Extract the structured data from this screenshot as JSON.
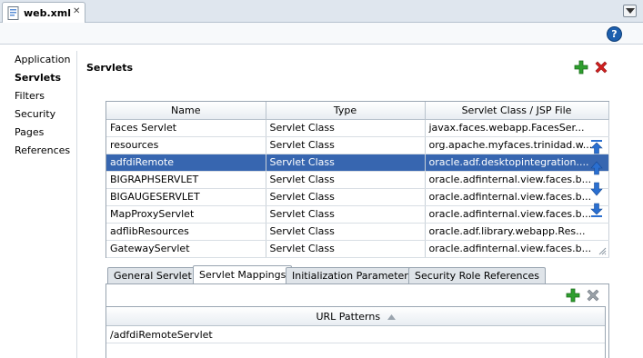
{
  "editor_tab": {
    "title": "web.xml",
    "close": "✕"
  },
  "help": {
    "label": "?"
  },
  "nav": {
    "items": [
      {
        "label": "Application",
        "selected": false
      },
      {
        "label": "Servlets",
        "selected": true
      },
      {
        "label": "Filters",
        "selected": false
      },
      {
        "label": "Security",
        "selected": false
      },
      {
        "label": "Pages",
        "selected": false
      },
      {
        "label": "References",
        "selected": false
      }
    ]
  },
  "servlets": {
    "title": "Servlets",
    "columns": [
      "Name",
      "Type",
      "Servlet Class / JSP File"
    ],
    "rows": [
      [
        "Faces Servlet",
        "Servlet Class",
        "javax.faces.webapp.FacesSer..."
      ],
      [
        "resources",
        "Servlet Class",
        "org.apache.myfaces.trinidad.w..."
      ],
      [
        "adfdiRemote",
        "Servlet Class",
        "oracle.adf.desktopintegration...."
      ],
      [
        "BIGRAPHSERVLET",
        "Servlet Class",
        "oracle.adfinternal.view.faces.b..."
      ],
      [
        "BIGAUGESERVLET",
        "Servlet Class",
        "oracle.adfinternal.view.faces.b..."
      ],
      [
        "MapProxyServlet",
        "Servlet Class",
        "oracle.adfinternal.view.faces.b..."
      ],
      [
        "adflibResources",
        "Servlet Class",
        "oracle.adf.library.webapp.Res..."
      ],
      [
        "GatewayServlet",
        "Servlet Class",
        "oracle.adfinternal.view.faces.b..."
      ]
    ],
    "selected_row": 2
  },
  "detail_tabs": {
    "tabs": [
      "General Servlet",
      "Servlet Mappings",
      "Initialization Parameters",
      "Security Role References"
    ],
    "active": 1
  },
  "mappings": {
    "column": "URL Patterns",
    "rows": [
      "/adfdiRemoteServlet"
    ]
  },
  "colors": {
    "selection": "#3766b0",
    "add_green": "#2e9e2e",
    "delete_red": "#d21f1f",
    "arrow_blue": "#2a6fd0"
  },
  "icons": {
    "file": "xml-file-icon",
    "add": "plus-icon",
    "delete": "delete-x-icon",
    "move_top": "move-to-top-icon",
    "move_up": "move-up-icon",
    "move_down": "move-down-icon",
    "move_bottom": "move-to-bottom-icon",
    "help": "help-icon",
    "sort": "sort-ascending-icon"
  }
}
